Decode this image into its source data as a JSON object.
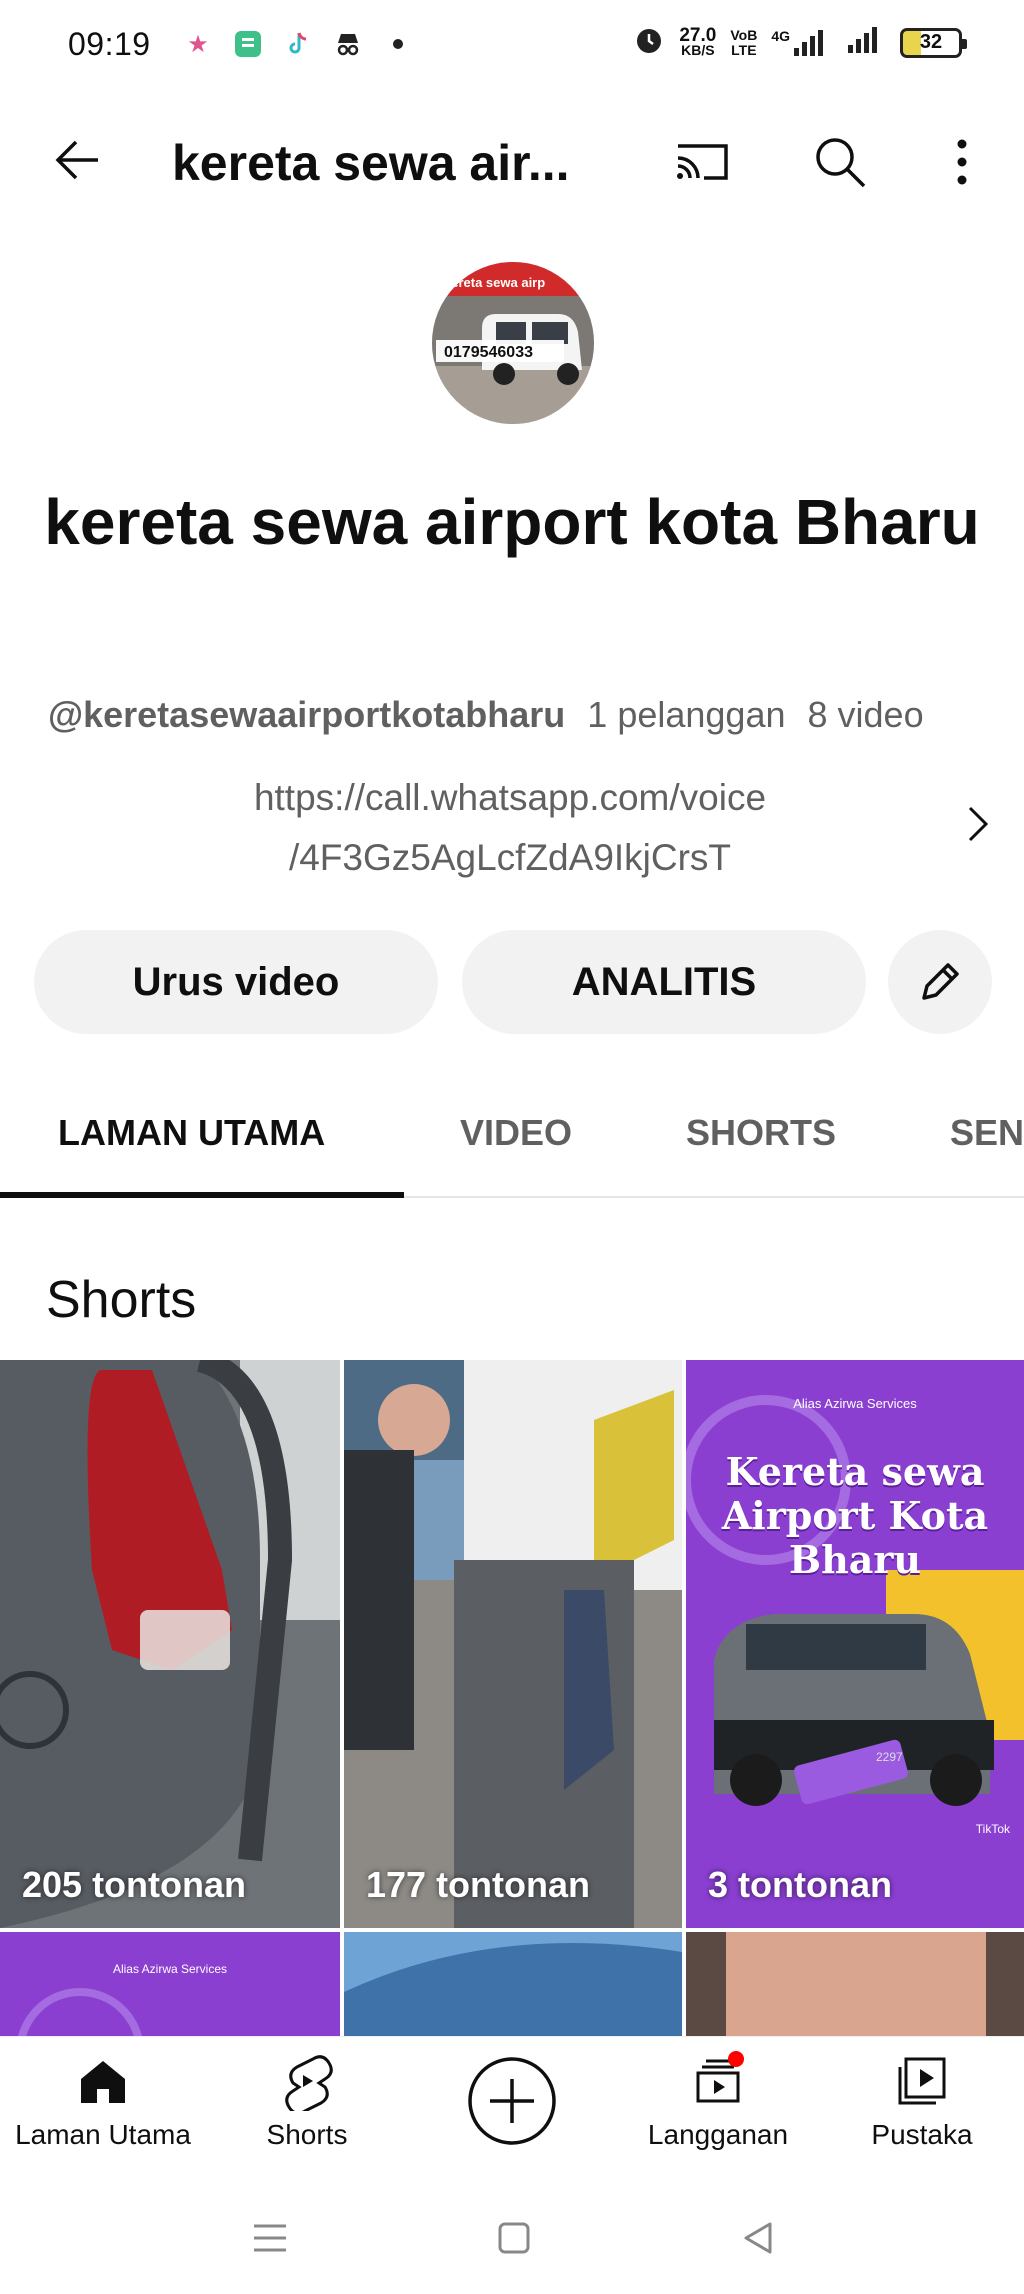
{
  "status_bar": {
    "time": "09:19",
    "net_speed_top": "27.0",
    "net_speed_bottom": "KB/S",
    "volte_top": "VoB",
    "volte_bottom": "LTE",
    "network": "4G",
    "battery": "32"
  },
  "app_bar": {
    "title": "kereta sewa air..."
  },
  "channel": {
    "avatar_banner_text": "kereta sewa airp",
    "avatar_phone": "0179546033",
    "name": "kereta sewa airport kota Bharu",
    "handle": "@keretasewaairportkotabharu",
    "subscribers": "1 pelanggan",
    "videos": "8 video",
    "link_line1": "https://call.whatsapp.com/voice",
    "link_line2": "/4F3Gz5AgLcfZdA9IkjCrsT"
  },
  "actions": {
    "manage_label": "Urus video",
    "analytics_label": "ANALITIS"
  },
  "tabs": [
    {
      "label": "LAMAN UTAMA",
      "active": true
    },
    {
      "label": "VIDEO",
      "active": false
    },
    {
      "label": "SHORTS",
      "active": false
    },
    {
      "label": "SEN",
      "active": false
    }
  ],
  "section": {
    "title": "Shorts"
  },
  "shorts": [
    {
      "views": "205 tontonan"
    },
    {
      "views": "177 tontonan"
    },
    {
      "views": "3 tontonan",
      "brand": "Alias Azirwa Services",
      "headline": "Kereta sewa Airport Kota Bharu",
      "plate": "2297",
      "tiktok": "TikTok"
    },
    {
      "brand": "Alias Azirwa Services"
    }
  ],
  "bottom_nav": [
    {
      "label": "Laman Utama",
      "icon": "home-icon"
    },
    {
      "label": "Shorts",
      "icon": "shorts-icon"
    },
    {
      "label": "Langganan",
      "icon": "subscriptions-icon"
    },
    {
      "label": "Pustaka",
      "icon": "library-icon"
    }
  ],
  "colors": {
    "accent": "#0f0f0f",
    "muted": "#606060",
    "pill_bg": "#f2f2f2",
    "short_purple": "#8a3fd1",
    "notification_dot": "#ff0000"
  }
}
